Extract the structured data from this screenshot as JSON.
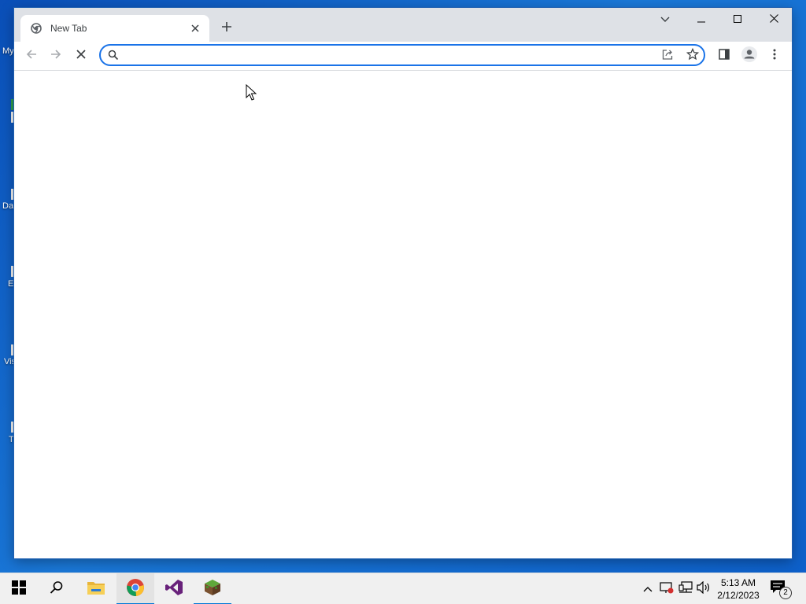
{
  "desktop": {
    "icons": [
      {
        "label": "My"
      },
      {
        "label": "Da"
      },
      {
        "label": "E"
      },
      {
        "label": "Vis"
      },
      {
        "label": "T"
      }
    ]
  },
  "browser": {
    "tab": {
      "title": "New Tab",
      "favicon": "chrome-icon"
    },
    "window_controls": [
      "tab-search-icon",
      "minimize-icon",
      "maximize-icon",
      "close-icon"
    ],
    "toolbar": {
      "back": "back-arrow-icon",
      "forward": "forward-arrow-icon",
      "reload": "stop-loading-icon",
      "omnibox": {
        "value": "",
        "placeholder": ""
      },
      "share": "share-icon",
      "bookmark": "star-icon",
      "side_panel": "side-panel-icon",
      "profile": "profile-icon",
      "menu": "kebab-menu-icon"
    },
    "accent_color": "#1a73e8"
  },
  "taskbar": {
    "apps": [
      {
        "name": "start-icon"
      },
      {
        "name": "search-icon"
      },
      {
        "name": "file-explorer-icon"
      },
      {
        "name": "chrome-icon",
        "active": true
      },
      {
        "name": "visual-studio-icon"
      },
      {
        "name": "minecraft-icon"
      }
    ],
    "tray": [
      "chevron-up-icon",
      "security-icon",
      "network-icon",
      "volume-icon"
    ],
    "clock": {
      "time": "5:13 AM",
      "date": "2/12/2023"
    },
    "notifications": {
      "count": "2"
    }
  }
}
